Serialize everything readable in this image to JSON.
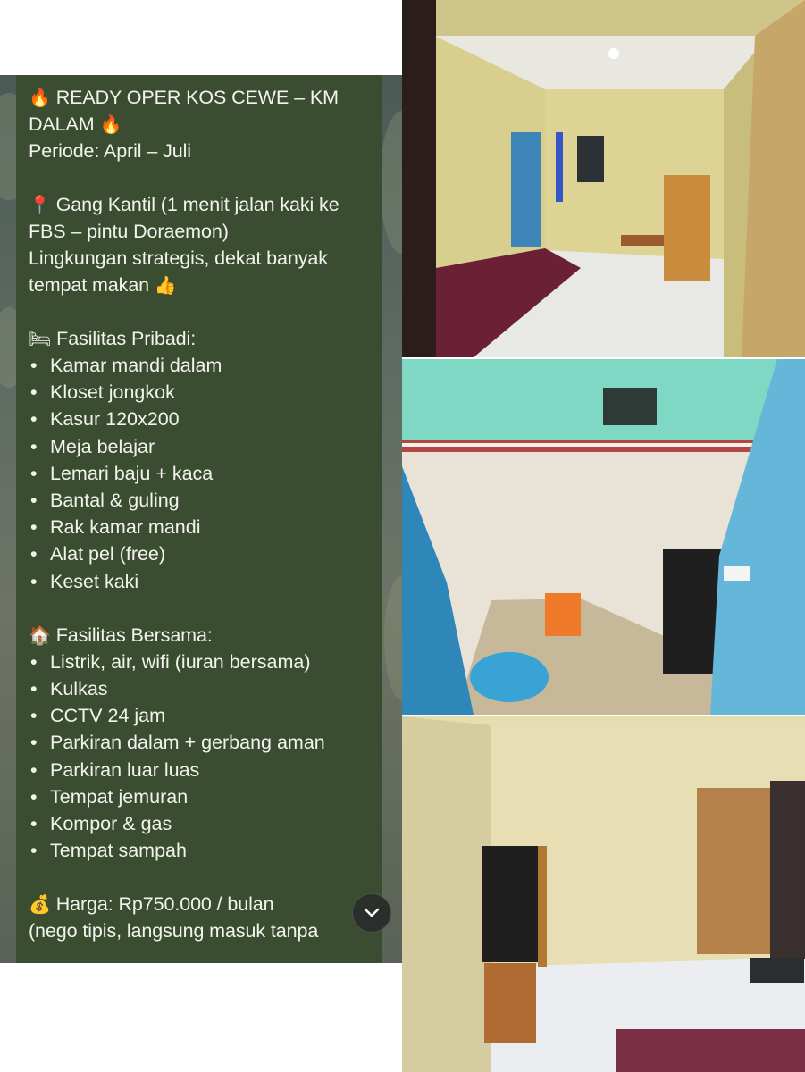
{
  "post": {
    "title_line1": "READY OPER KOS CEWE – KM",
    "title_line2": "DALAM",
    "period": "Periode: April – Juli",
    "location_line1": "Gang Kantil (1 menit jalan kaki ke",
    "location_line2": "FBS – pintu Doraemon)",
    "env_line1": "Lingkungan strategis, dekat banyak",
    "env_line2": "tempat makan",
    "private_heading": "Fasilitas Pribadi:",
    "private_items": [
      "Kamar mandi dalam",
      "Kloset jongkok",
      "Kasur 120x200",
      "Meja belajar",
      "Lemari baju + kaca",
      "Bantal & guling",
      "Rak kamar mandi",
      "Alat pel (free)",
      "Keset kaki"
    ],
    "shared_heading": "Fasilitas Bersama:",
    "shared_items": [
      "Listrik, air, wifi (iuran bersama)",
      "Kulkas",
      "CCTV 24 jam",
      "Parkiran dalam + gerbang aman",
      "Parkiran luar luas",
      "Tempat jemuran",
      "Kompor & gas",
      "Tempat sampah"
    ],
    "price_line": "Harga: Rp750.000 / bulan",
    "price_note": "(nego tipis, langsung masuk tanpa"
  },
  "icons": {
    "fire": "fire-icon",
    "pin": "pin-icon",
    "thumbs": "thumbs-up-icon",
    "bed": "bed-icon",
    "house": "house-icon",
    "money": "money-bag-icon",
    "scroll": "chevron-down-icon"
  },
  "colors": {
    "bubble": "#3b4d30",
    "text": "#f3f3ee",
    "scroll_button": "#2a2f2b"
  }
}
